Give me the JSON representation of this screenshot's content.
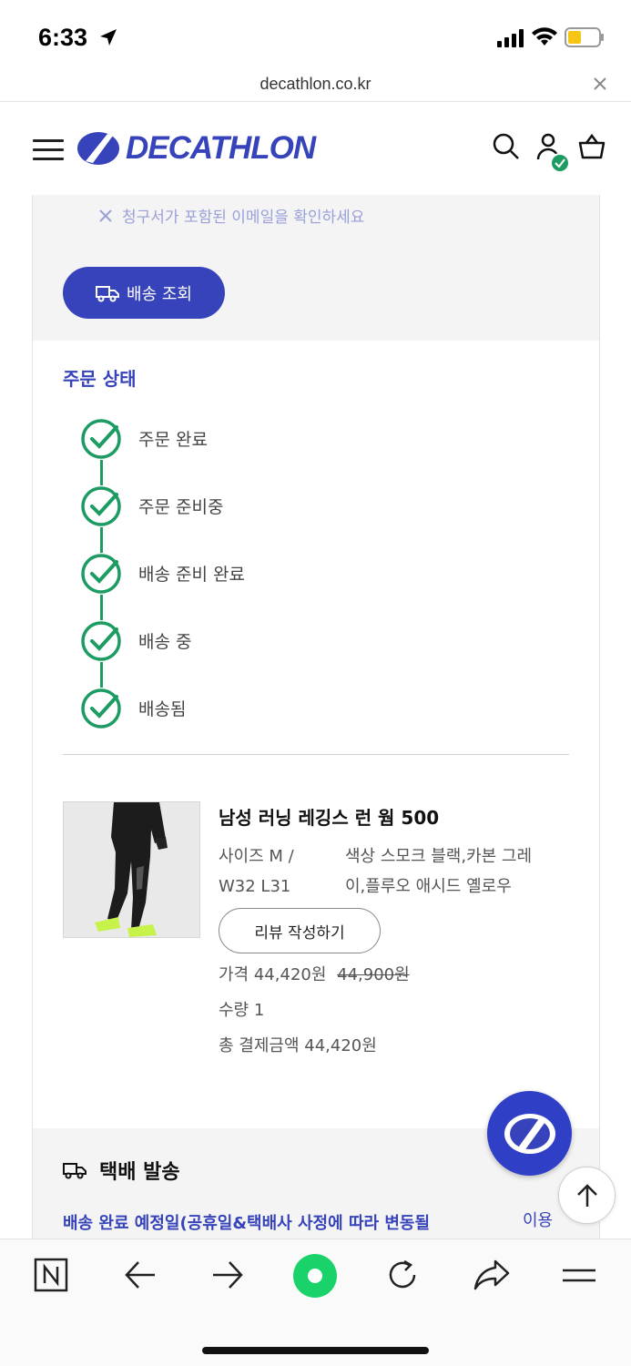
{
  "status_bar": {
    "time": "6:33"
  },
  "browser": {
    "url": "decathlon.co.kr"
  },
  "header": {
    "brand": "DECATHLON"
  },
  "order": {
    "invoice_note": "청구서가 포함된 이메일을 확인하세요",
    "track_button": "배송 조회",
    "status_title": "주문 상태",
    "steps": [
      "주문 완료",
      "주문 준비중",
      "배송 준비 완료",
      "배송 중",
      "배송됨"
    ]
  },
  "product": {
    "name": "남성 러닝 레깅스 런 웜 500",
    "size_line1": "사이즈 M /",
    "size_line2": "W32 L31",
    "color_line1": "색상 스모크 블랙,카본 그레",
    "color_line2": "이,플루오 애시드 옐로우",
    "review_button": "리뷰 작성하기",
    "price_label": "가격",
    "price": "44,420원",
    "original_price": "44,900원",
    "qty_label": "수량",
    "qty": "1",
    "total_label": "총 결제금액",
    "total": "44,420원"
  },
  "delivery": {
    "title": "택배 발송",
    "note": "배송 완료 예정일(공휴일&택배사 사정에 따라 변동될",
    "terms_link": "이용"
  },
  "colors": {
    "brand": "#3643ba",
    "success": "#1c9b62"
  },
  "icons": [
    "location-arrow-icon",
    "signal-icon",
    "wifi-icon",
    "battery-icon",
    "close-icon",
    "menu-icon",
    "search-icon",
    "user-icon",
    "basket-icon",
    "truck-icon",
    "check-circle-icon",
    "arrow-up-icon",
    "back-icon",
    "forward-icon",
    "reload-icon",
    "share-icon"
  ]
}
